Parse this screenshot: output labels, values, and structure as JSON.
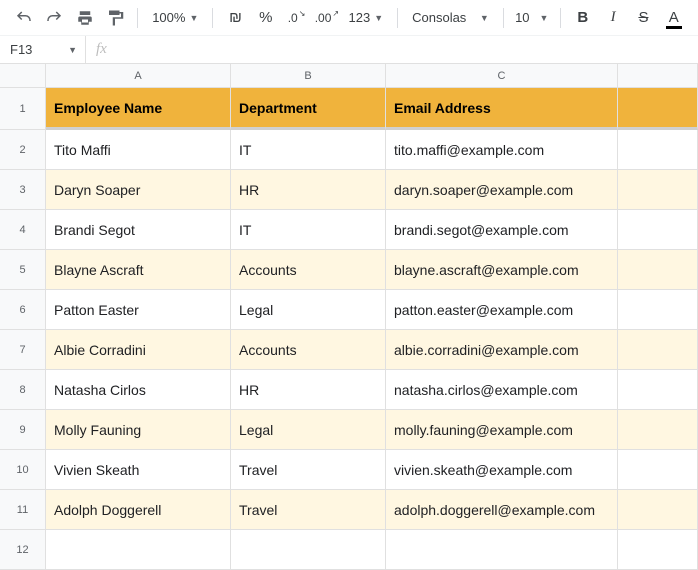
{
  "toolbar": {
    "zoom": "100%",
    "currency_symbol": "₪",
    "percent": "%",
    "dec_dec": ".0",
    "dec_inc": ".00",
    "numfmt": "123",
    "font": "Consolas",
    "font_size": "10",
    "bold": "B",
    "italic": "I",
    "strike": "S",
    "textcolor": "A"
  },
  "namebox": {
    "ref": "F13",
    "fx": "fx"
  },
  "columns": [
    "A",
    "B",
    "C",
    ""
  ],
  "header_row": {
    "num": "1",
    "name": "Employee Name",
    "dept": "Department",
    "email": "Email Address"
  },
  "rows": [
    {
      "num": "2",
      "name": "Tito Maffi",
      "dept": "IT",
      "email": "tito.maffi@example.com"
    },
    {
      "num": "3",
      "name": "Daryn Soaper",
      "dept": "HR",
      "email": "daryn.soaper@example.com"
    },
    {
      "num": "4",
      "name": "Brandi Segot",
      "dept": "IT",
      "email": "brandi.segot@example.com"
    },
    {
      "num": "5",
      "name": "Blayne Ascraft",
      "dept": "Accounts",
      "email": "blayne.ascraft@example.com"
    },
    {
      "num": "6",
      "name": "Patton Easter",
      "dept": "Legal",
      "email": "patton.easter@example.com"
    },
    {
      "num": "7",
      "name": "Albie Corradini",
      "dept": "Accounts",
      "email": "albie.corradini@example.com"
    },
    {
      "num": "8",
      "name": "Natasha Cirlos",
      "dept": "HR",
      "email": "natasha.cirlos@example.com"
    },
    {
      "num": "9",
      "name": "Molly Fauning",
      "dept": "Legal",
      "email": "molly.fauning@example.com"
    },
    {
      "num": "10",
      "name": "Vivien Skeath",
      "dept": "Travel",
      "email": "vivien.skeath@example.com"
    },
    {
      "num": "11",
      "name": "Adolph Doggerell",
      "dept": "Travel",
      "email": "adolph.doggerell@example.com"
    }
  ],
  "empty_row": {
    "num": "12"
  }
}
